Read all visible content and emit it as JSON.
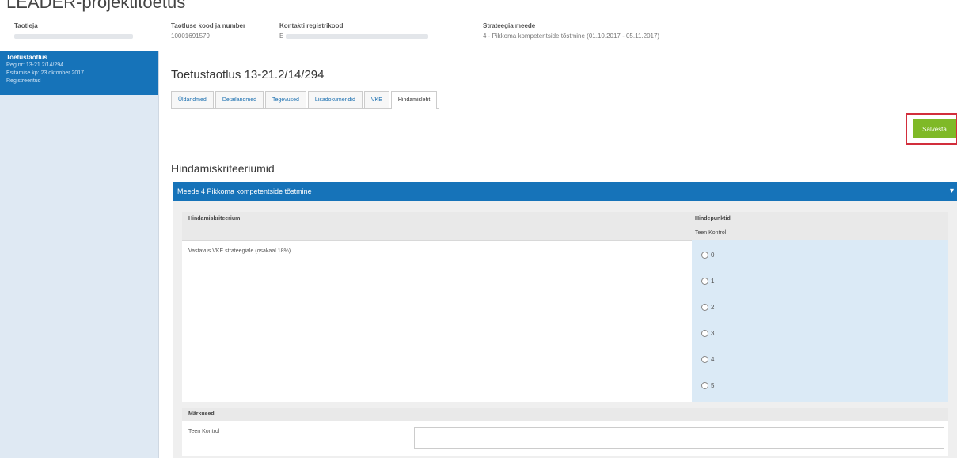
{
  "app": {
    "title": "LEADER-projektitoetus"
  },
  "info": {
    "applicant_label": "Taotleja",
    "registry_label": "Taotluse kood ja number",
    "registry_value": "10001691579",
    "contact_label": "Kontakti registrikood",
    "contact_value": "E",
    "strategy_label": "Strateegia meede",
    "strategy_value": "4 - Pikkoma kompetentside tõstmine (01.10.2017 - 05.11.2017)"
  },
  "sidebar": {
    "items": [
      {
        "title": "Toetustaotlus",
        "line1": "Reg nr: 13-21.2/14/294",
        "line2": "Esitamise kp: 23 oktoober 2017",
        "line3": "Registreeritud"
      }
    ]
  },
  "main": {
    "title": "Toetustaotlus 13-21.2/14/294",
    "tabs": [
      {
        "label": "Üldandmed"
      },
      {
        "label": "Detailandmed"
      },
      {
        "label": "Tegevused"
      },
      {
        "label": "Lisadokumendid"
      },
      {
        "label": "VKE"
      },
      {
        "label": "Hindamisleht"
      }
    ],
    "save_label": "Salvesta",
    "section_title": "Hindamiskriteeriumid",
    "accordion_label": "Meede 4 Pikkoma kompetentside tõstmine"
  },
  "criteria": {
    "col_criterion": "Hindamiskriteerium",
    "col_scores": "Hindepunktid",
    "col_evaluator": "Teen Kontrol",
    "row_text": "Vastavus VKE strateegiale (osakaal 18%)",
    "options": [
      "0",
      "1",
      "2",
      "3",
      "4",
      "5"
    ]
  },
  "comments": {
    "header": "Märkused",
    "label": "Teen Kontrol",
    "value": ""
  },
  "colors": {
    "primary_blue": "#1673b9",
    "save_green": "#7fb927",
    "highlight_red": "#d22e3c",
    "score_bg": "#dbeaf6"
  }
}
